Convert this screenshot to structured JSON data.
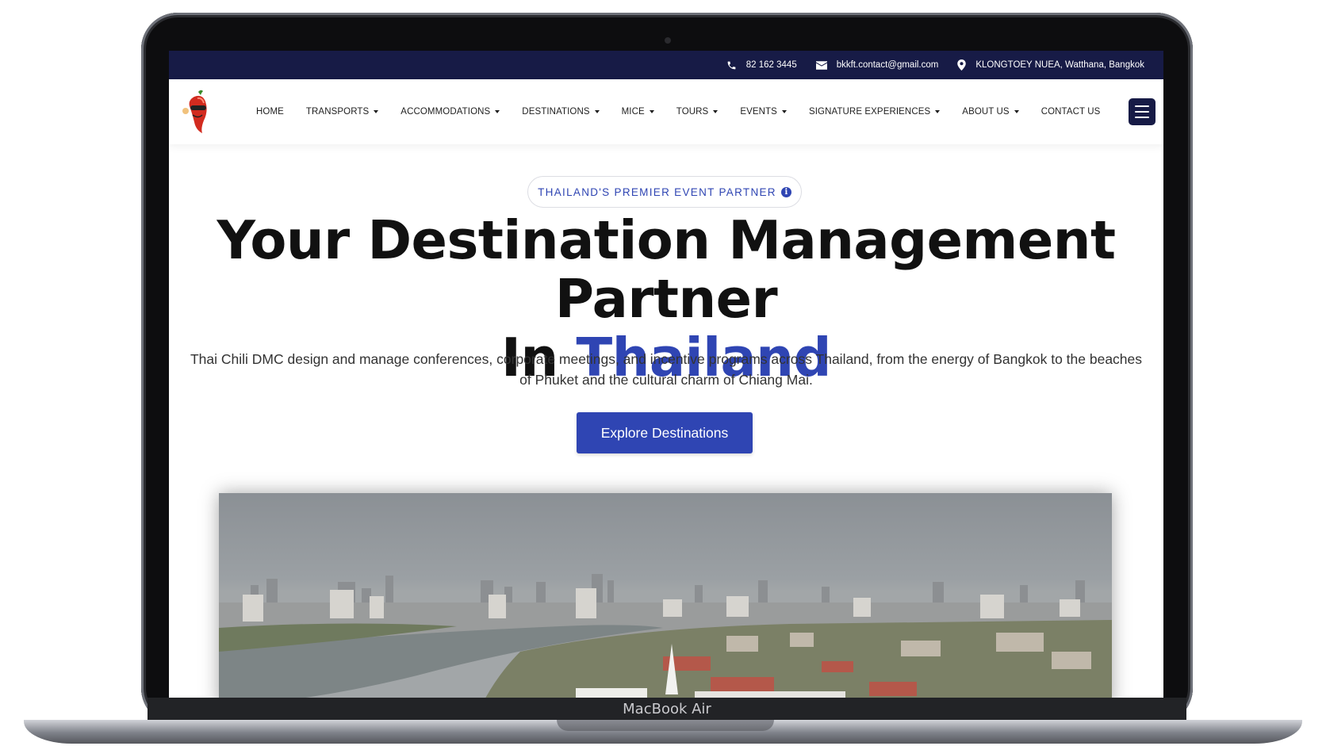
{
  "topbar": {
    "phone": "82 162 3445",
    "email": "bkkft.contact@gmail.com",
    "address": "KLONGTOEY NUEA, Watthana, Bangkok",
    "icons": [
      "phone-icon",
      "envelope-icon",
      "map-pin-icon"
    ]
  },
  "nav": {
    "items": [
      {
        "label": "HOME",
        "dropdown": false
      },
      {
        "label": "TRANSPORTS",
        "dropdown": true
      },
      {
        "label": "ACCOMMODATIONS",
        "dropdown": true
      },
      {
        "label": "DESTINATIONS",
        "dropdown": true
      },
      {
        "label": "MICE",
        "dropdown": true
      },
      {
        "label": "TOURS",
        "dropdown": true
      },
      {
        "label": "EVENTS",
        "dropdown": true
      },
      {
        "label": "SIGNATURE EXPERIENCES",
        "dropdown": true
      },
      {
        "label": "ABOUT US",
        "dropdown": true
      },
      {
        "label": "CONTACT US",
        "dropdown": false
      }
    ]
  },
  "hero": {
    "badge": "THAILAND'S PREMIER EVENT PARTNER",
    "headline_line1": "Your Destination Management Partner",
    "headline_prefix": "In",
    "headline_accent": "Thailand",
    "subtext": "Thai Chili DMC design and manage conferences, corporate meetings, and incentive programs across Thailand, from the energy of Bangkok to the beaches of Phuket and the cultural charm of Chiang Mai.",
    "cta": "Explore Destinations"
  },
  "device": {
    "label": "MacBook Air"
  },
  "colors": {
    "topbar_bg": "#171b46",
    "accent": "#2f45b3",
    "text": "#111111"
  }
}
